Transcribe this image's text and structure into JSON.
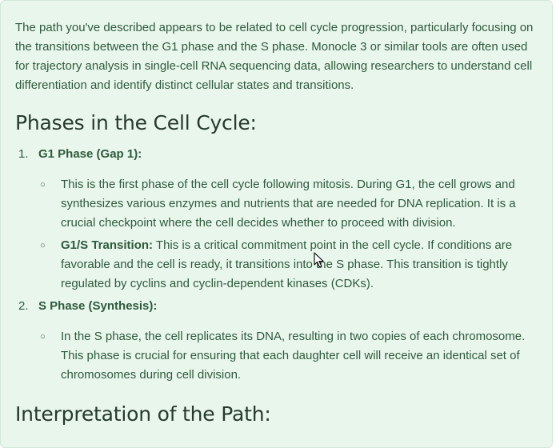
{
  "intro": "The path you've described appears to be related to cell cycle progression, particularly focusing on the transitions between the G1 phase and the S phase. Monocle 3 or similar tools are often used for trajectory analysis in single-cell RNA sequencing data, allowing researchers to understand cell differentiation and identify distinct cellular states and transitions.",
  "heading_phases": "Phases in the Cell Cycle:",
  "phases": [
    {
      "number": "1.",
      "title": "G1 Phase (Gap 1):",
      "details": [
        {
          "bold": "",
          "text": "This is the first phase of the cell cycle following mitosis. During G1, the cell grows and synthesizes various enzymes and nutrients that are needed for DNA replication. It is a crucial checkpoint where the cell decides whether to proceed with division."
        },
        {
          "bold": "G1/S Transition:",
          "text": " This is a critical commitment point in the cell cycle. If conditions are favorable and the cell is ready, it transitions into the S phase. This transition is tightly regulated by cyclins and cyclin-dependent kinases (CDKs)."
        }
      ]
    },
    {
      "number": "2.",
      "title": "S Phase (Synthesis):",
      "details": [
        {
          "bold": "",
          "text": "In the S phase, the cell replicates its DNA, resulting in two copies of each chromosome. This phase is crucial for ensuring that each daughter cell will receive an identical set of chromosomes during cell division."
        }
      ]
    }
  ],
  "heading_interpretation": "Interpretation of the Path:",
  "bullet_glyph": "○",
  "icons": {
    "cursor": "mouse-pointer-icon"
  }
}
